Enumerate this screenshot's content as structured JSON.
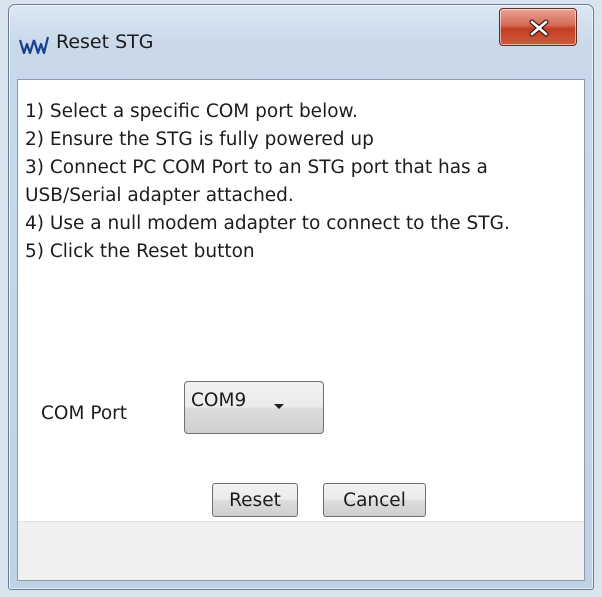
{
  "window": {
    "title": "Reset STG",
    "app_icon": "ww-logo-icon",
    "close_icon": "close-icon"
  },
  "instructions": [
    "1) Select a specific COM port below.",
    "2) Ensure the STG is fully powered up",
    "3) Connect PC COM Port to an STG port that has a USB/Serial adapter attached.",
    "4) Use a null modem adapter to connect to the STG.",
    "5) Click the Reset button"
  ],
  "com_port": {
    "label": "COM Port",
    "selected": "COM9",
    "arrow_icon": "chevron-down-icon"
  },
  "buttons": {
    "reset_label": "Reset",
    "cancel_label": "Cancel"
  },
  "colors": {
    "close_button": "#c8432a",
    "title_bar": "#c9d9ea",
    "client_background": "#ffffff",
    "footer_background": "#f0f0f0",
    "logo_blue": "#1b3f8f"
  }
}
